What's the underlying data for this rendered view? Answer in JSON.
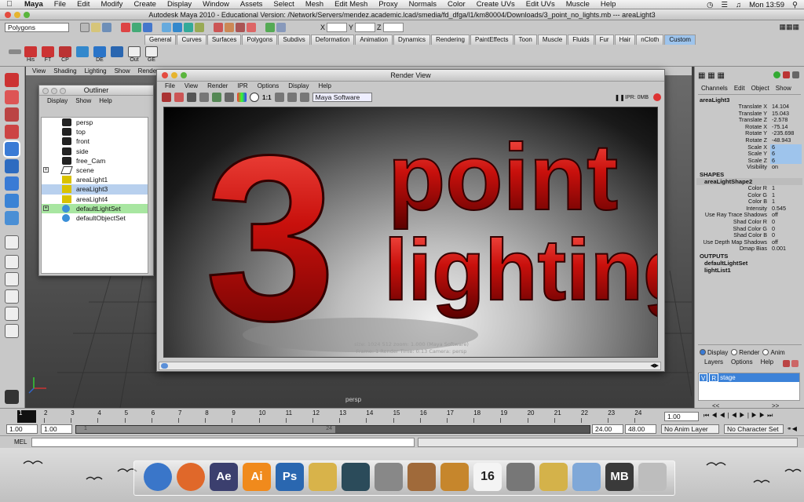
{
  "menubar": {
    "apple": "",
    "items": [
      "Maya",
      "File",
      "Edit",
      "Modify",
      "Create",
      "Display",
      "Window",
      "Assets",
      "Select",
      "Mesh",
      "Edit Mesh",
      "Proxy",
      "Normals",
      "Color",
      "Create UVs",
      "Edit UVs",
      "Muscle",
      "Help"
    ],
    "clock": "Mon 13:59"
  },
  "window": {
    "title": "Autodesk Maya 2010 - Educational Version: /Network/Servers/mendez.academic.lcad/smedia/fd_dfga/l1/km80004/Downloads/3_point_no_lights.mb  ---  areaLight3"
  },
  "statusline": {
    "menu_set": "Polygons",
    "x_label": "X",
    "y_label": "Y",
    "z_label": "Z"
  },
  "shelf": {
    "tabs": [
      "General",
      "Curves",
      "Surfaces",
      "Polygons",
      "Subdivs",
      "Deformation",
      "Animation",
      "Dynamics",
      "Rendering",
      "PaintEffects",
      "Toon",
      "Muscle",
      "Fluids",
      "Fur",
      "Hair",
      "nCloth",
      "Custom"
    ],
    "active_tab": "Custom",
    "buttons": [
      "His",
      "FT",
      "CP",
      "",
      "DE",
      "",
      "Out",
      "GE"
    ]
  },
  "viewport": {
    "menu": [
      "View",
      "Shading",
      "Lighting",
      "Show",
      "Renderer"
    ],
    "camera_label": "persp"
  },
  "outliner": {
    "title": "Outliner",
    "menu": [
      "Display",
      "Show",
      "Help"
    ],
    "items": [
      {
        "label": "persp",
        "icon": "camera-icon"
      },
      {
        "label": "top",
        "icon": "camera-icon"
      },
      {
        "label": "front",
        "icon": "camera-icon"
      },
      {
        "label": "side",
        "icon": "camera-icon"
      },
      {
        "label": "free_Cam",
        "icon": "camera-icon"
      },
      {
        "label": "scene",
        "icon": "plane-icon",
        "expand": "+"
      },
      {
        "label": "areaLight1",
        "icon": "area-light-icon"
      },
      {
        "label": "areaLight3",
        "icon": "area-light-icon"
      },
      {
        "label": "areaLight4",
        "icon": "area-light-icon"
      },
      {
        "label": "defaultLightSet",
        "icon": "set-icon",
        "expand": "+"
      },
      {
        "label": "defaultObjectSet",
        "icon": "set-icon"
      }
    ]
  },
  "render_view": {
    "title": "Render View",
    "menu": [
      "File",
      "View",
      "Render",
      "IPR",
      "Options",
      "Display",
      "Help"
    ],
    "ratio": "1:1",
    "renderer": "Maya Software",
    "ipr": "IPR: 0MB",
    "image_text_number": "3",
    "image_text_word1": "point",
    "image_text_word2": "lighting",
    "info_line1": "size: 1024  512  zoom: 1.000       (Maya Software)",
    "info_line2": "Frame: 1        Render Time: 0:13        Camera: persp"
  },
  "channel_box": {
    "tabs": [
      "Channels",
      "Edit",
      "Object",
      "Show"
    ],
    "object": "areaLight3",
    "transform": [
      {
        "label": "Translate X",
        "value": "14.104"
      },
      {
        "label": "Translate Y",
        "value": "15.043"
      },
      {
        "label": "Translate Z",
        "value": "-2.578"
      },
      {
        "label": "Rotate X",
        "value": "-75.14"
      },
      {
        "label": "Rotate Y",
        "value": "-235.698"
      },
      {
        "label": "Rotate Z",
        "value": "-48.943"
      },
      {
        "label": "Scale X",
        "value": "6"
      },
      {
        "label": "Scale Y",
        "value": "6"
      },
      {
        "label": "Scale Z",
        "value": "6"
      },
      {
        "label": "Visibility",
        "value": "on"
      }
    ],
    "shapes_label": "SHAPES",
    "shape_name": "areaLightShape2",
    "shape_attrs": [
      {
        "label": "Color R",
        "value": "1"
      },
      {
        "label": "Color G",
        "value": "1"
      },
      {
        "label": "Color B",
        "value": "1"
      },
      {
        "label": "Intensity",
        "value": "0.545"
      },
      {
        "label": "Use Ray Trace Shadows",
        "value": "off"
      },
      {
        "label": "Shad Color R",
        "value": "0"
      },
      {
        "label": "Shad Color G",
        "value": "0"
      },
      {
        "label": "Shad Color B",
        "value": "0"
      },
      {
        "label": "Use Depth Map Shadows",
        "value": "off"
      },
      {
        "label": "Dmap Bias",
        "value": "0.001"
      }
    ],
    "outputs_label": "OUTPUTS",
    "outputs": [
      "defaultLightSet",
      "lightList1"
    ]
  },
  "layers": {
    "modes": [
      "Display",
      "Render",
      "Anim"
    ],
    "menu": [
      "Layers",
      "Options",
      "Help"
    ],
    "layer_v": "V",
    "layer_r": "R",
    "layer_name": "stage",
    "nav_prev": "<<",
    "nav_next": ">>"
  },
  "timeline": {
    "ticks": [
      "1",
      "2",
      "3",
      "4",
      "5",
      "6",
      "7",
      "8",
      "9",
      "10",
      "11",
      "12",
      "13",
      "14",
      "15",
      "16",
      "17",
      "18",
      "19",
      "20",
      "21",
      "22",
      "23",
      "24"
    ],
    "current_frame": "1.00"
  },
  "range": {
    "start": "1.00",
    "start2": "1.00",
    "slider_start": "1",
    "slider_end": "24",
    "end": "24.00",
    "end2": "48.00",
    "anim_layer": "No Anim Layer",
    "character_set": "No Character Set"
  },
  "cmdline": {
    "label": "MEL"
  },
  "dock": {
    "apps": [
      {
        "name": "finder-icon",
        "label": "",
        "color": "#3a76c9"
      },
      {
        "name": "firefox-icon",
        "label": "",
        "color": "#e0682a"
      },
      {
        "name": "after-effects-icon",
        "label": "Ae",
        "color": "#3b3f6e"
      },
      {
        "name": "illustrator-icon",
        "label": "Ai",
        "color": "#f08a1c"
      },
      {
        "name": "photoshop-icon",
        "label": "Ps",
        "color": "#2a67b0"
      },
      {
        "name": "pencil-icon",
        "label": "",
        "color": "#d8b34a"
      },
      {
        "name": "maya-icon",
        "label": "",
        "color": "#2b4b5a"
      },
      {
        "name": "image-capture-icon",
        "label": "",
        "color": "#888"
      },
      {
        "name": "preview-icon",
        "label": "",
        "color": "#a06a3a"
      },
      {
        "name": "garageband-icon",
        "label": "",
        "color": "#c6862c"
      },
      {
        "name": "ical-icon",
        "label": "16",
        "color": "#f4f4f4"
      },
      {
        "name": "system-prefs-icon",
        "label": "",
        "color": "#777"
      },
      {
        "name": "keychain-icon",
        "label": "",
        "color": "#d4b24a"
      },
      {
        "name": "folder-icon",
        "label": "",
        "color": "#7fa8d8"
      },
      {
        "name": "maya-file-icon",
        "label": "MB",
        "color": "#3a3a3a"
      },
      {
        "name": "trash-icon",
        "label": "",
        "color": "#bdbdbd"
      }
    ]
  }
}
